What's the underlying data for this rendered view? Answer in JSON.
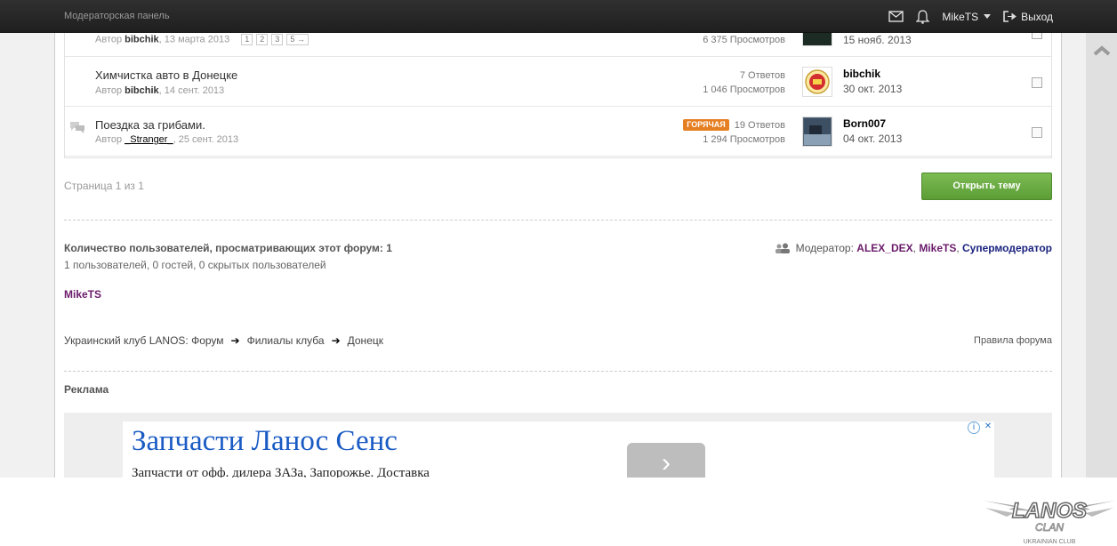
{
  "topbar": {
    "mod_panel": "Модераторская панель",
    "username": "MikeTS",
    "logout": "Выход"
  },
  "topics": [
    {
      "title": "",
      "author_prefix": "Автор",
      "author": "bibchik",
      "date": ", 13 марта 2013",
      "pages": [
        "1",
        "2",
        "3",
        "5 →"
      ],
      "replies": "",
      "views": "6 375 Просмотров",
      "last_by": "",
      "last_date": "15 нояб. 2013"
    },
    {
      "title": "Химчистка авто в Донецке",
      "author_prefix": "Автор",
      "author": "bibchik",
      "date": ", 14 сент. 2013",
      "replies": "7 Ответов",
      "views": "1 046 Просмотров",
      "last_by": "bibchik",
      "last_date": "30 окт. 2013"
    },
    {
      "title": "Поездка за грибами.",
      "author_prefix": "Автор",
      "author": "_Stranger_",
      "date": ", 25 сент. 2013",
      "badge": "ГОРЯЧАЯ",
      "replies": "19 Ответов",
      "views": "1 294 Просмотров",
      "last_by": "Born007",
      "last_date": "04 окт. 2013"
    }
  ],
  "pagination": {
    "info": "Страница 1 из 1"
  },
  "actions": {
    "open_topic": "Открыть тему"
  },
  "viewers": {
    "title": "Количество пользователей, просматривающих этот форум: 1",
    "subtitle": "1 пользователей, 0 гостей, 0 скрытых пользователей",
    "online_user": "MikeTS"
  },
  "moderators": {
    "label": "Модератор:",
    "list": [
      "ALEX_DEX",
      "MikeTS",
      "Супермодератор"
    ]
  },
  "breadcrumb": [
    "Украинский клуб LANOS: Форум",
    "Филиалы клуба",
    "Донецк"
  ],
  "rules_link": "Правила форума",
  "ad": {
    "section_title": "Реклама",
    "headline": "Запчасти Ланос Сенс",
    "text": "Запчасти от офф. дилера ЗАЗа, Запорожье. Доставка",
    "go": "›"
  },
  "logo": {
    "text": "LANOS",
    "sub": "CLAN",
    "tagline": "UKRAINIAN CLUB"
  },
  "colors": {
    "topbar": "#2a2a2a",
    "accent_green": "#6aac42",
    "hot_badge": "#e67e22",
    "mod_purple": "#6a1b6a",
    "ad_blue": "#1a5bc4"
  }
}
